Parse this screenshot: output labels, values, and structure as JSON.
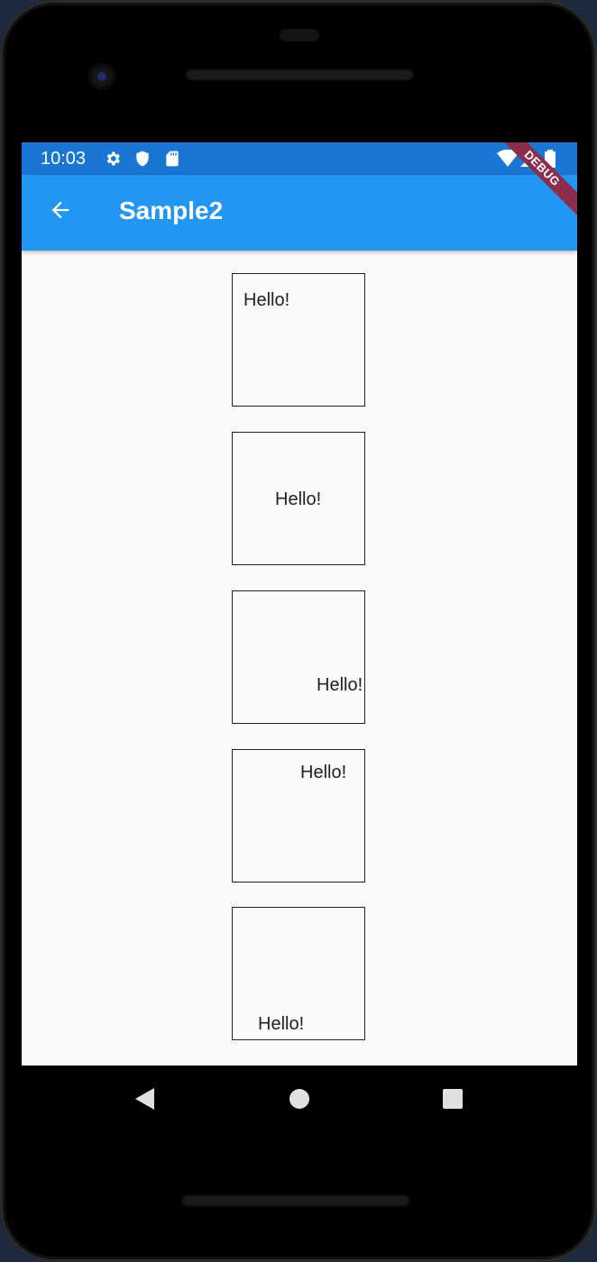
{
  "status_bar": {
    "time": "10:03",
    "icons": [
      "gear-icon",
      "shield-icon",
      "sd-card-icon",
      "wifi-icon",
      "signal-icon",
      "battery-icon"
    ],
    "color": "#1976d2"
  },
  "app_bar": {
    "title": "Sample2",
    "back_icon": "arrow-back-icon",
    "color": "#2196f3"
  },
  "debug_banner": {
    "label": "DEBUG",
    "color": "#8b2d4b"
  },
  "boxes": [
    {
      "text": "Hello!"
    },
    {
      "text": "Hello!"
    },
    {
      "text": "Hello!"
    },
    {
      "text": "Hello!"
    },
    {
      "text": "Hello!"
    }
  ],
  "nav_bar": {
    "icons": [
      "back-triangle-icon",
      "home-circle-icon",
      "recents-square-icon"
    ]
  }
}
